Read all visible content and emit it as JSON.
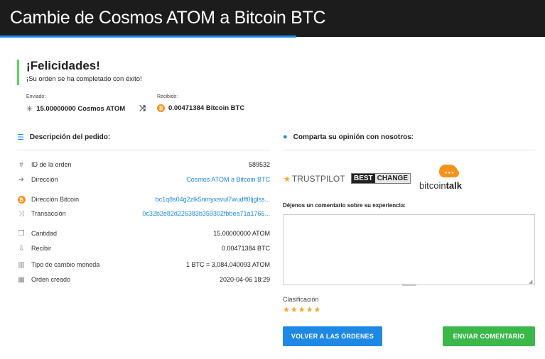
{
  "header": {
    "title": "Cambie de Cosmos ATOM a Bitcoin BTC"
  },
  "success": {
    "title": "¡Felicidades!",
    "message": "¡Su orden se ha completado con éxito!"
  },
  "summary": {
    "sent_label": "Enviado:",
    "sent_value": "15.00000000 Cosmos ATOM",
    "received_label": "Recibido:",
    "received_value": "0.00471384 Bitcoin BTC",
    "sent_icon": "cosmos-icon",
    "swap_icon": "shuffle-icon",
    "received_icon": "bitcoin-icon"
  },
  "order": {
    "title": "Descripción del pedido:",
    "rows": [
      {
        "icon": "hash-icon",
        "label": "ID de la orden",
        "value": "589532",
        "link": false
      },
      {
        "icon": "direction-icon",
        "label": "Dirección",
        "value": "Cosmos ATOM a Bitcoin BTC",
        "link": true
      },
      {
        "icon": "bitcoin-icon",
        "label": "Dirección Bitcoin",
        "value": "bc1q8s04g2zlk5nmyxsvul7wudff0ljglss...",
        "link": true
      },
      {
        "icon": "shuffle-icon",
        "label": "Transacción",
        "value": "0c32b2e82d226383b359302fbbea71a1765...",
        "link": true
      },
      {
        "icon": "copy-icon",
        "label": "Cantidad",
        "value": "15.00000000 ATOM",
        "link": false
      },
      {
        "icon": "download-icon",
        "label": "Recibir",
        "value": "0.00471384 BTC",
        "link": false
      },
      {
        "icon": "bar-chart-icon",
        "label": "Tipo de cambio moneda",
        "value": "1 BTC = 3,084.040093 ATOM",
        "link": false
      },
      {
        "icon": "calendar-icon",
        "label": "Orden creado",
        "value": "2020-04-06 18:29",
        "link": false
      }
    ]
  },
  "opinion": {
    "title": "Comparta su opinión con nosotros:",
    "logos": {
      "trustpilot": "TRUSTPILOT",
      "bestchange_1": "BEST",
      "bestchange_2": "CHANGE",
      "bitcointalk_1": "bitcoin",
      "bitcointalk_2": "talk"
    },
    "comment_label": "Déjenos un comentario sobre su experiencia:",
    "comment_value": "",
    "rating_label": "Clasificación",
    "rating": 5,
    "rating_max": 5
  },
  "buttons": {
    "back": "VOLVER A LAS ÓRDENES",
    "send": "ENVIAR COMENTARIO"
  },
  "colors": {
    "accent": "#1e88e5",
    "success": "#3cb84a",
    "bitcoin": "#f7931a",
    "star": "#f5a623"
  }
}
